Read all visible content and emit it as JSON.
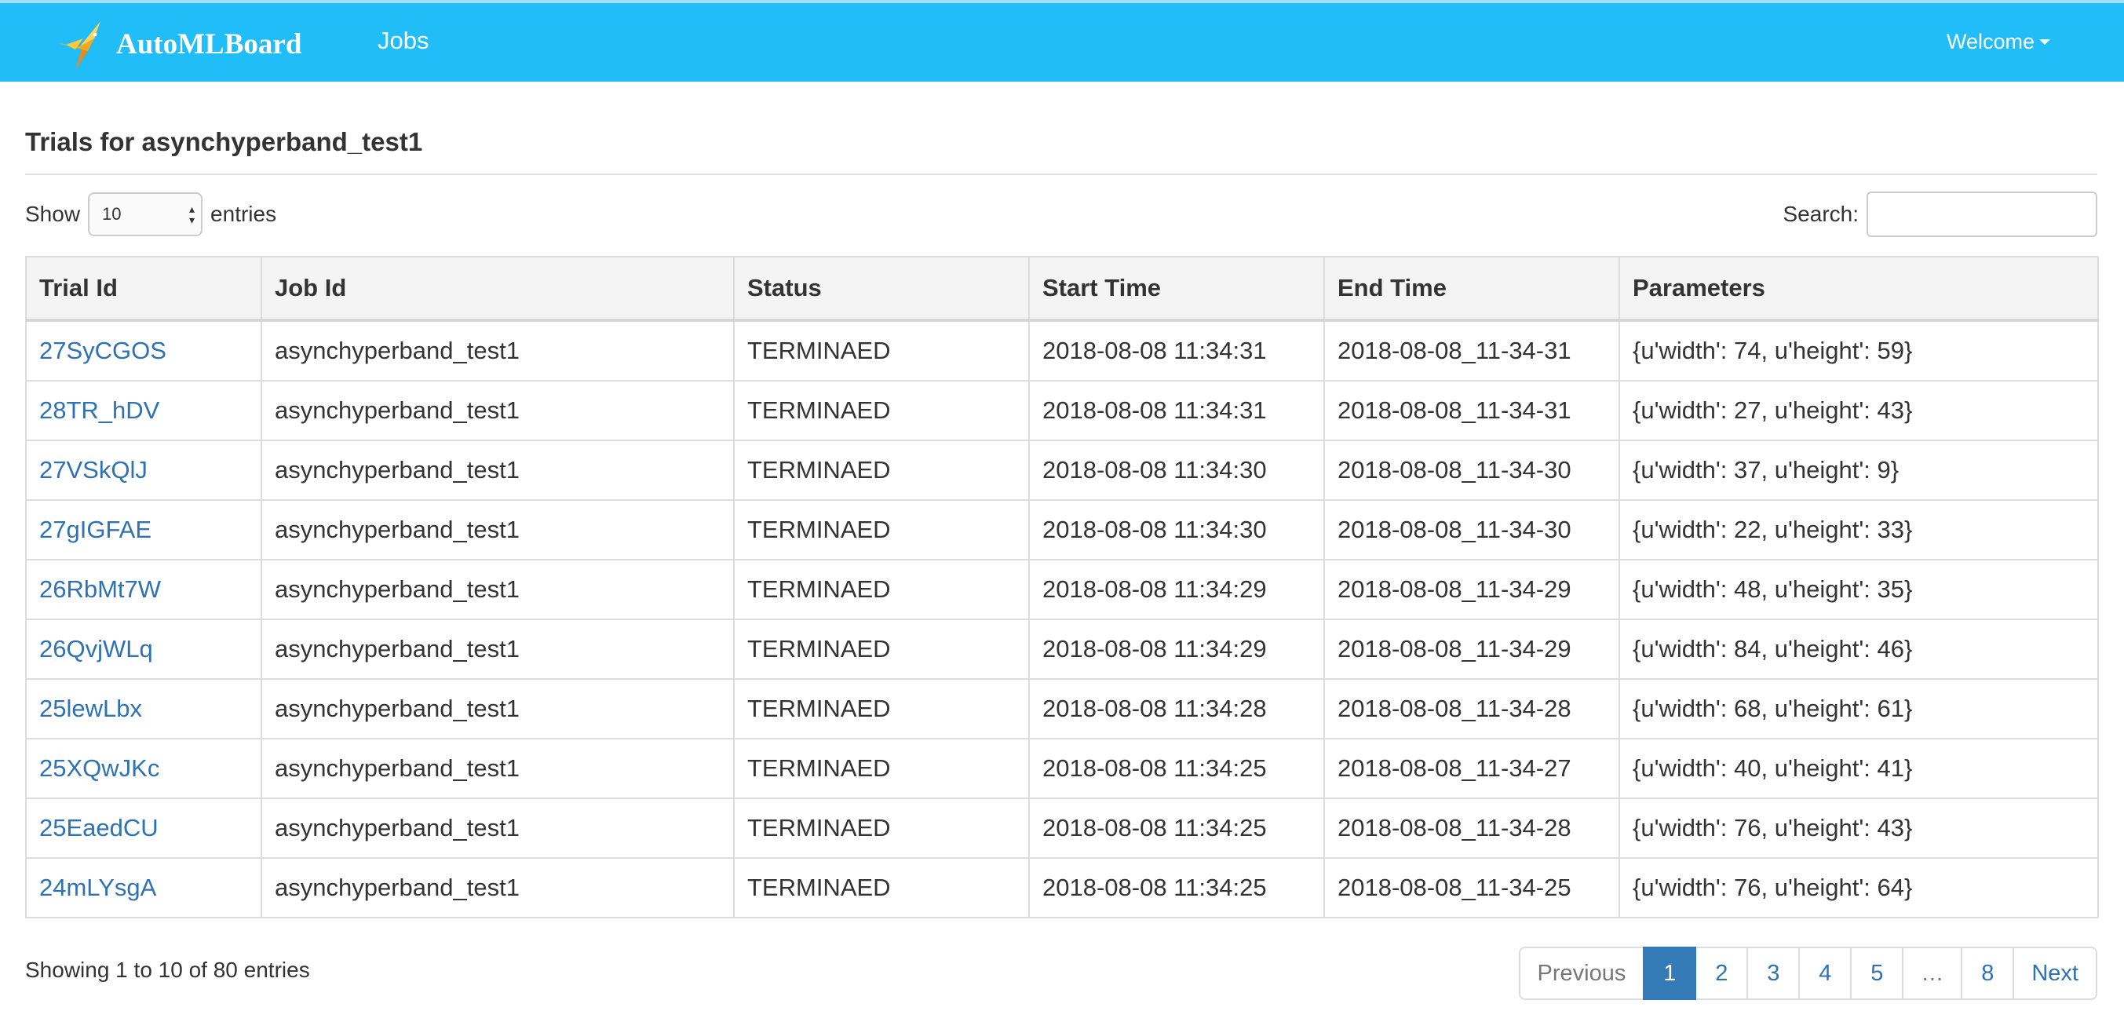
{
  "navbar": {
    "brand": "AutoMLBoard",
    "nav_jobs": "Jobs",
    "welcome": "Welcome",
    "bg_color": "#20bdf8"
  },
  "page": {
    "title": "Trials for asynchyperband_test1"
  },
  "controls": {
    "show_label": "Show",
    "entries_value": "10",
    "entries_label": "entries",
    "search_label": "Search:",
    "search_value": ""
  },
  "table": {
    "columns": [
      "Trial Id",
      "Job Id",
      "Status",
      "Start Time",
      "End Time",
      "Parameters"
    ],
    "rows": [
      {
        "trial_id": "27SyCGOS",
        "job_id": "asynchyperband_test1",
        "status": "TERMINAED",
        "start": "2018-08-08 11:34:31",
        "end": "2018-08-08_11-34-31",
        "params": "{u'width': 74, u'height': 59}"
      },
      {
        "trial_id": "28TR_hDV",
        "job_id": "asynchyperband_test1",
        "status": "TERMINAED",
        "start": "2018-08-08 11:34:31",
        "end": "2018-08-08_11-34-31",
        "params": "{u'width': 27, u'height': 43}"
      },
      {
        "trial_id": "27VSkQlJ",
        "job_id": "asynchyperband_test1",
        "status": "TERMINAED",
        "start": "2018-08-08 11:34:30",
        "end": "2018-08-08_11-34-30",
        "params": "{u'width': 37, u'height': 9}"
      },
      {
        "trial_id": "27gIGFAE",
        "job_id": "asynchyperband_test1",
        "status": "TERMINAED",
        "start": "2018-08-08 11:34:30",
        "end": "2018-08-08_11-34-30",
        "params": "{u'width': 22, u'height': 33}"
      },
      {
        "trial_id": "26RbMt7W",
        "job_id": "asynchyperband_test1",
        "status": "TERMINAED",
        "start": "2018-08-08 11:34:29",
        "end": "2018-08-08_11-34-29",
        "params": "{u'width': 48, u'height': 35}"
      },
      {
        "trial_id": "26QvjWLq",
        "job_id": "asynchyperband_test1",
        "status": "TERMINAED",
        "start": "2018-08-08 11:34:29",
        "end": "2018-08-08_11-34-29",
        "params": "{u'width': 84, u'height': 46}"
      },
      {
        "trial_id": "25lewLbx",
        "job_id": "asynchyperband_test1",
        "status": "TERMINAED",
        "start": "2018-08-08 11:34:28",
        "end": "2018-08-08_11-34-28",
        "params": "{u'width': 68, u'height': 61}"
      },
      {
        "trial_id": "25XQwJKc",
        "job_id": "asynchyperband_test1",
        "status": "TERMINAED",
        "start": "2018-08-08 11:34:25",
        "end": "2018-08-08_11-34-27",
        "params": "{u'width': 40, u'height': 41}"
      },
      {
        "trial_id": "25EaedCU",
        "job_id": "asynchyperband_test1",
        "status": "TERMINAED",
        "start": "2018-08-08 11:34:25",
        "end": "2018-08-08_11-34-28",
        "params": "{u'width': 76, u'height': 43}"
      },
      {
        "trial_id": "24mLYsgA",
        "job_id": "asynchyperband_test1",
        "status": "TERMINAED",
        "start": "2018-08-08 11:34:25",
        "end": "2018-08-08_11-34-25",
        "params": "{u'width': 76, u'height': 64}"
      }
    ]
  },
  "footer": {
    "info": "Showing 1 to 10 of 80 entries",
    "pagination": {
      "previous": "Previous",
      "next": "Next",
      "pages": [
        "1",
        "2",
        "3",
        "4",
        "5",
        "…",
        "8"
      ],
      "active_page": "1"
    }
  }
}
